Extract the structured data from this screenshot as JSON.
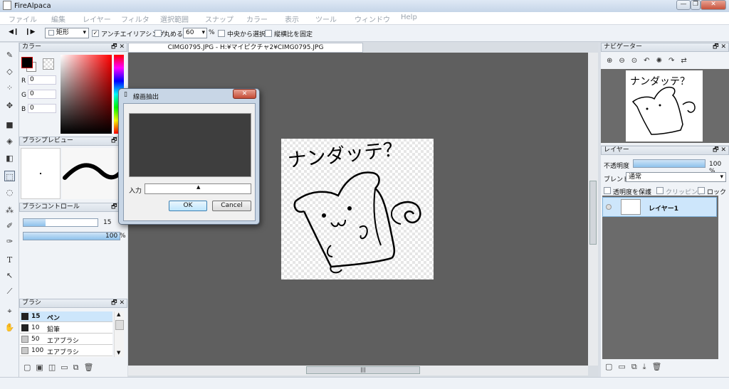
{
  "window": {
    "title": "FireAlpaca",
    "minimize": "—",
    "restore": "❐",
    "close": "✕"
  },
  "menu": [
    "ファイル",
    "編集",
    "レイヤー",
    "フィルタ",
    "選択範囲",
    "スナップ",
    "カラー",
    "表示",
    "ツール",
    "ウィンドウ",
    "Help"
  ],
  "toolbar": {
    "shape_select": "矩形",
    "antialias_label": "アンチエイリアシング",
    "antialias_checked": true,
    "round_label": "丸める",
    "round_value": "60",
    "round_unit": "%",
    "center_label": "中央から選択",
    "aspect_label": "縦横比を固定"
  },
  "color_panel": {
    "title": "カラー",
    "r_label": "R",
    "r_value": "0",
    "g_label": "G",
    "g_value": "0",
    "b_label": "B",
    "b_value": "0",
    "accent": "#ff0000"
  },
  "brush_preview": {
    "title": "ブラシプレビュー"
  },
  "brush_control": {
    "title": "ブラシコントロール",
    "size_value": "15",
    "opacity_value": "100 %"
  },
  "brush_panel": {
    "title": "ブラシ",
    "items": [
      {
        "size": "15",
        "name": "ペン",
        "selected": true
      },
      {
        "size": "10",
        "name": "鉛筆",
        "selected": false
      },
      {
        "size": "50",
        "name": "エアブラシ",
        "selected": false
      },
      {
        "size": "100",
        "name": "エアブラシ",
        "selected": false
      }
    ]
  },
  "document": {
    "tab": "CIMG0795.JPG - H:¥マイピクチャ2¥CIMG0795.JPG",
    "scroll_grip": "|||"
  },
  "artwork": {
    "text": "ナンダッテ？"
  },
  "dialog": {
    "title": "線画抽出",
    "close": "✕",
    "input_label": "入力",
    "ok": "OK",
    "cancel": "Cancel"
  },
  "navigator": {
    "title": "ナビゲーター"
  },
  "layer_panel": {
    "title": "レイヤー",
    "opacity_label": "不透明度",
    "opacity_value": "100 %",
    "blend_label": "ブレンド",
    "blend_value": "通常",
    "protect_label": "透明度を保護",
    "clip_label": "クリッピング",
    "lock_label": "ロック",
    "layer_name": "レイヤー1"
  }
}
